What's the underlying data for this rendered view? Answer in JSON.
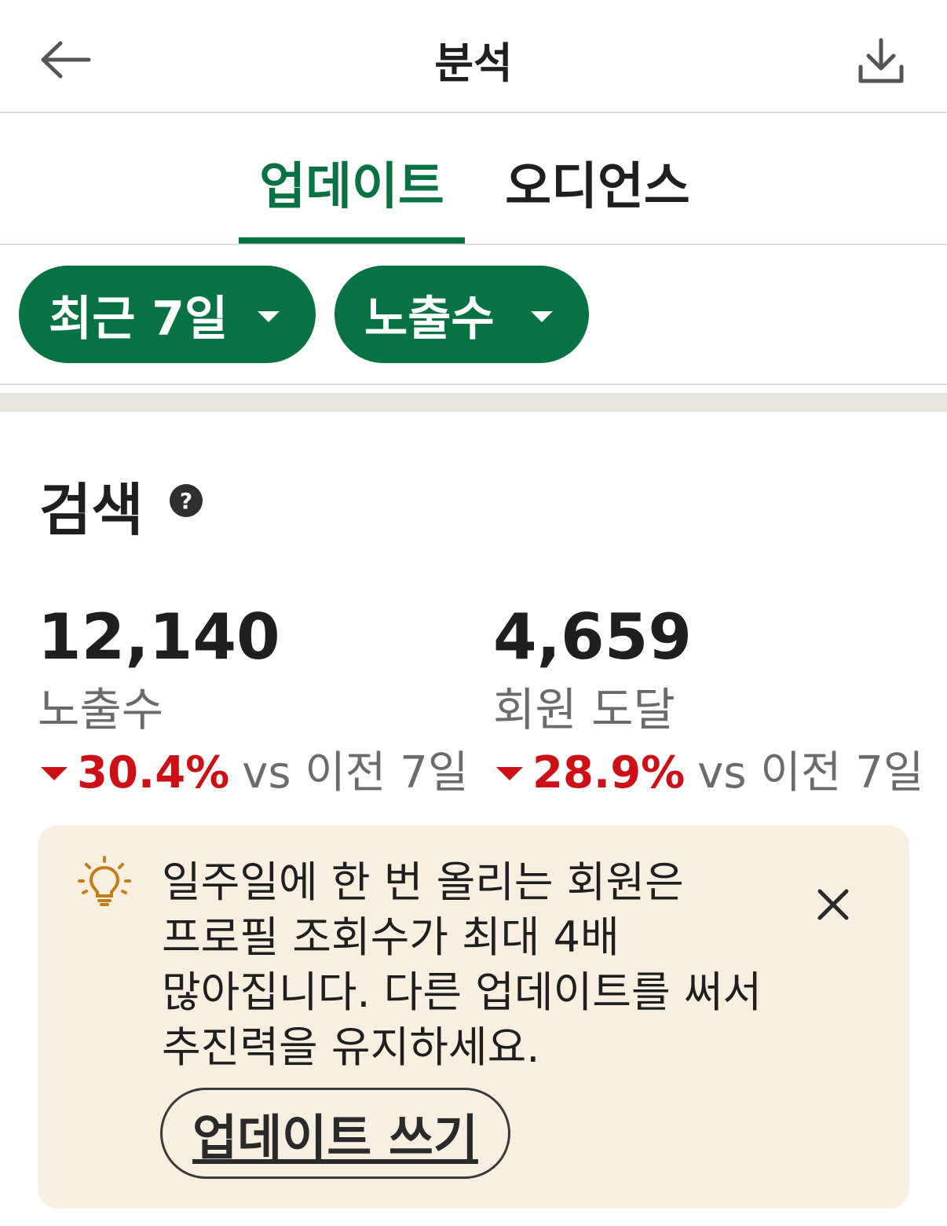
{
  "header": {
    "title": "분석",
    "back_icon": "arrow-left-icon",
    "download_icon": "download-icon"
  },
  "tabs": [
    {
      "label": "업데이트",
      "active": true
    },
    {
      "label": "오디언스",
      "active": false
    }
  ],
  "filters": {
    "date_range": "최근 7일",
    "metric": "노출수"
  },
  "section": {
    "title": "검색",
    "help_icon": "question-circle-icon",
    "help_glyph": "?"
  },
  "stats": [
    {
      "value": "12,140",
      "label": "노출수",
      "change": "30.4%",
      "direction": "down",
      "comparison": "vs 이전 7일"
    },
    {
      "value": "4,659",
      "label": "회원 도달",
      "change": "28.9%",
      "direction": "down",
      "comparison": "vs 이전 7일"
    }
  ],
  "tip": {
    "icon": "lightbulb-icon",
    "lines": [
      "일주일에 한 번 올리는 회원은",
      "프로필 조회수가 최대 4배",
      "많아집니다. 다른 업데이트를 써서",
      "추진력을 유지하세요."
    ],
    "cta_label": "업데이트 쓰기",
    "close_icon": "close-icon"
  },
  "colors": {
    "brand_green": "#087242",
    "negative_red": "#cc1016",
    "tip_background": "#f9efe1",
    "bulb_gold": "#c37d16"
  }
}
